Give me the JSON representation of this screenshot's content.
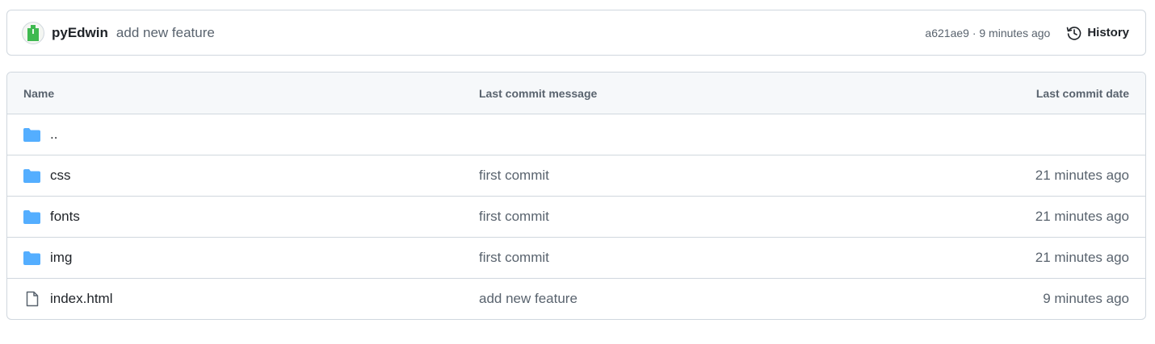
{
  "commit": {
    "author": "pyEdwin",
    "message": "add new feature",
    "meta": "a621ae9 · 9 minutes ago",
    "history_label": "History"
  },
  "table": {
    "headers": {
      "name": "Name",
      "message": "Last commit message",
      "date": "Last commit date"
    },
    "rows": [
      {
        "name": "..",
        "icon": "folder-icon",
        "message": "",
        "date": ""
      },
      {
        "name": "css",
        "icon": "folder-icon",
        "message": "first commit",
        "date": "21 minutes ago"
      },
      {
        "name": "fonts",
        "icon": "folder-icon",
        "message": "first commit",
        "date": "21 minutes ago"
      },
      {
        "name": "img",
        "icon": "folder-icon",
        "message": "first commit",
        "date": "21 minutes ago"
      },
      {
        "name": "index.html",
        "icon": "file-icon",
        "message": "add new feature",
        "date": "9 minutes ago"
      }
    ]
  },
  "colors": {
    "folder": "#54aeff",
    "border": "#d0d7de",
    "muted": "#59636e"
  }
}
